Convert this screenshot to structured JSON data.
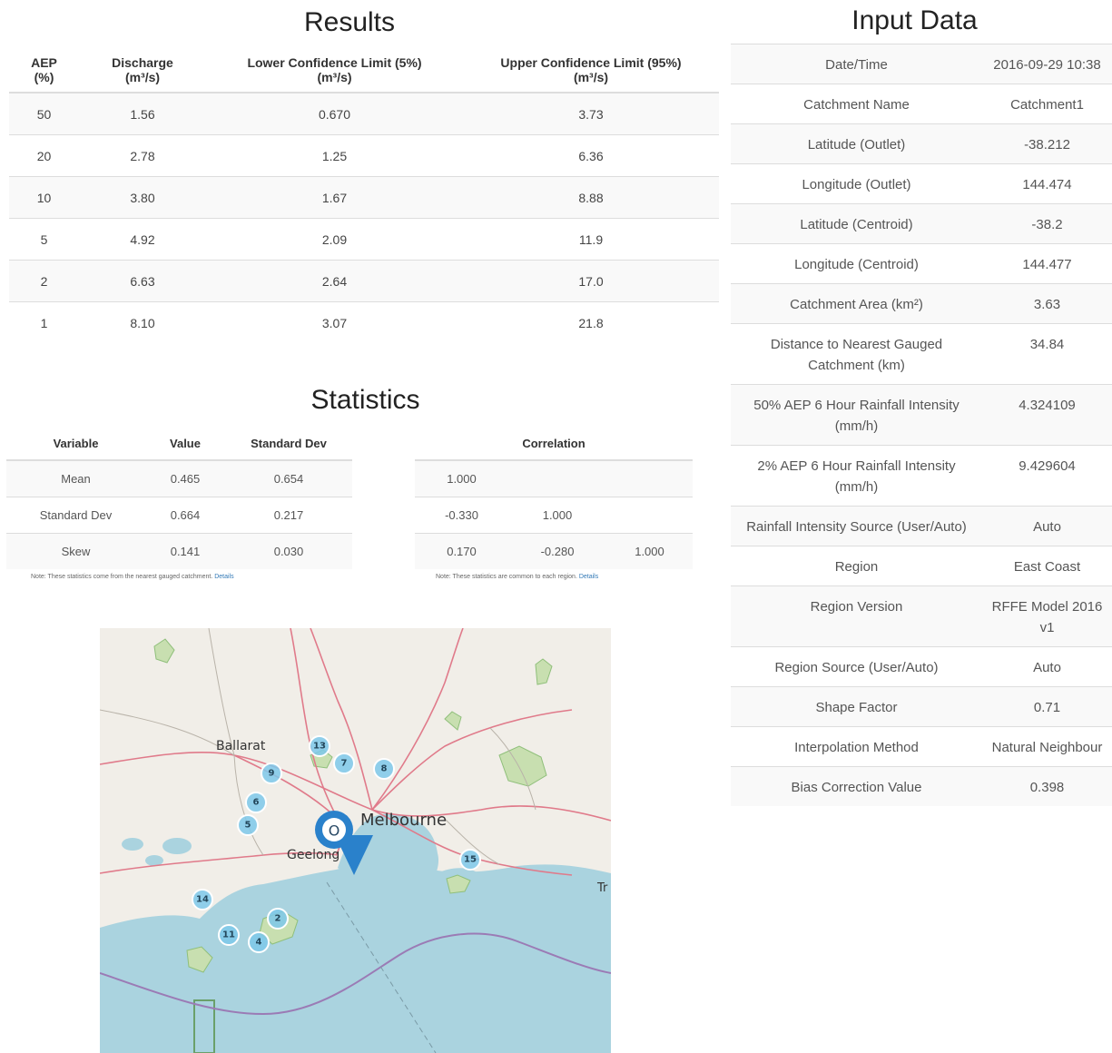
{
  "results": {
    "title": "Results",
    "headers": [
      [
        "AEP",
        "(%)"
      ],
      [
        "Discharge",
        "(m³/s)"
      ],
      [
        "Lower Confidence Limit (5%)",
        "(m³/s)"
      ],
      [
        "Upper Confidence Limit (95%)",
        "(m³/s)"
      ]
    ],
    "rows": [
      [
        "50",
        "1.56",
        "0.670",
        "3.73"
      ],
      [
        "20",
        "2.78",
        "1.25",
        "6.36"
      ],
      [
        "10",
        "3.80",
        "1.67",
        "8.88"
      ],
      [
        "5",
        "4.92",
        "2.09",
        "11.9"
      ],
      [
        "2",
        "6.63",
        "2.64",
        "17.0"
      ],
      [
        "1",
        "8.10",
        "3.07",
        "21.8"
      ]
    ]
  },
  "statistics": {
    "title": "Statistics",
    "headers": [
      "Variable",
      "Value",
      "Standard Dev"
    ],
    "rows": [
      [
        "Mean",
        "0.465",
        "0.654"
      ],
      [
        "Standard Dev",
        "0.664",
        "0.217"
      ],
      [
        "Skew",
        "0.141",
        "0.030"
      ]
    ],
    "note": "Note: These statistics come from the nearest gauged catchment.",
    "note_link": "Details",
    "correlation_header": "Correlation",
    "correlation_rows": [
      [
        "1.000",
        "",
        ""
      ],
      [
        "-0.330",
        "1.000",
        ""
      ],
      [
        "0.170",
        "-0.280",
        "1.000"
      ]
    ],
    "correlation_note": "Note: These statistics are common to each region.",
    "correlation_note_link": "Details"
  },
  "input": {
    "title": "Input Data",
    "rows": [
      {
        "label": "Date/Time",
        "value": "2016-09-29 10:38"
      },
      {
        "label": "Catchment Name",
        "value": "Catchment1"
      },
      {
        "label": "Latitude (Outlet)",
        "value": "-38.212"
      },
      {
        "label": "Longitude (Outlet)",
        "value": "144.474"
      },
      {
        "label": "Latitude (Centroid)",
        "value": "-38.2"
      },
      {
        "label": "Longitude (Centroid)",
        "value": "144.477"
      },
      {
        "label": "Catchment Area (km²)",
        "value": "3.63"
      },
      {
        "label": "Distance to Nearest Gauged Catchment (km)",
        "value": "34.84"
      },
      {
        "label": "50% AEP 6 Hour Rainfall Intensity (mm/h)",
        "value": "4.324109"
      },
      {
        "label": "2% AEP 6 Hour Rainfall Intensity (mm/h)",
        "value": "9.429604"
      },
      {
        "label": "Rainfall Intensity Source (User/Auto)",
        "value": "Auto"
      },
      {
        "label": "Region",
        "value": "East Coast"
      },
      {
        "label": "Region Version",
        "value": "RFFE Model 2016 v1"
      },
      {
        "label": "Region Source (User/Auto)",
        "value": "Auto"
      },
      {
        "label": "Shape Factor",
        "value": "0.71"
      },
      {
        "label": "Interpolation Method",
        "value": "Natural Neighbour"
      },
      {
        "label": "Bias Correction Value",
        "value": "0.398"
      }
    ]
  },
  "map": {
    "places": {
      "ballarat": "Ballarat",
      "melbourne": "Melbourne",
      "geelong": "Geelong",
      "edge": "Tr"
    },
    "pin_label": "O",
    "markers": [
      "13",
      "7",
      "9",
      "8",
      "6",
      "5",
      "15",
      "14",
      "2",
      "11",
      "4"
    ],
    "colors": {
      "water": "#aad3df",
      "land": "#f1eee8",
      "park": "#c8dfb0",
      "road": "#e07a8a",
      "marker": "#7ec8ea",
      "pin": "#2a81cb",
      "boundary": "#9b7bb5"
    }
  }
}
